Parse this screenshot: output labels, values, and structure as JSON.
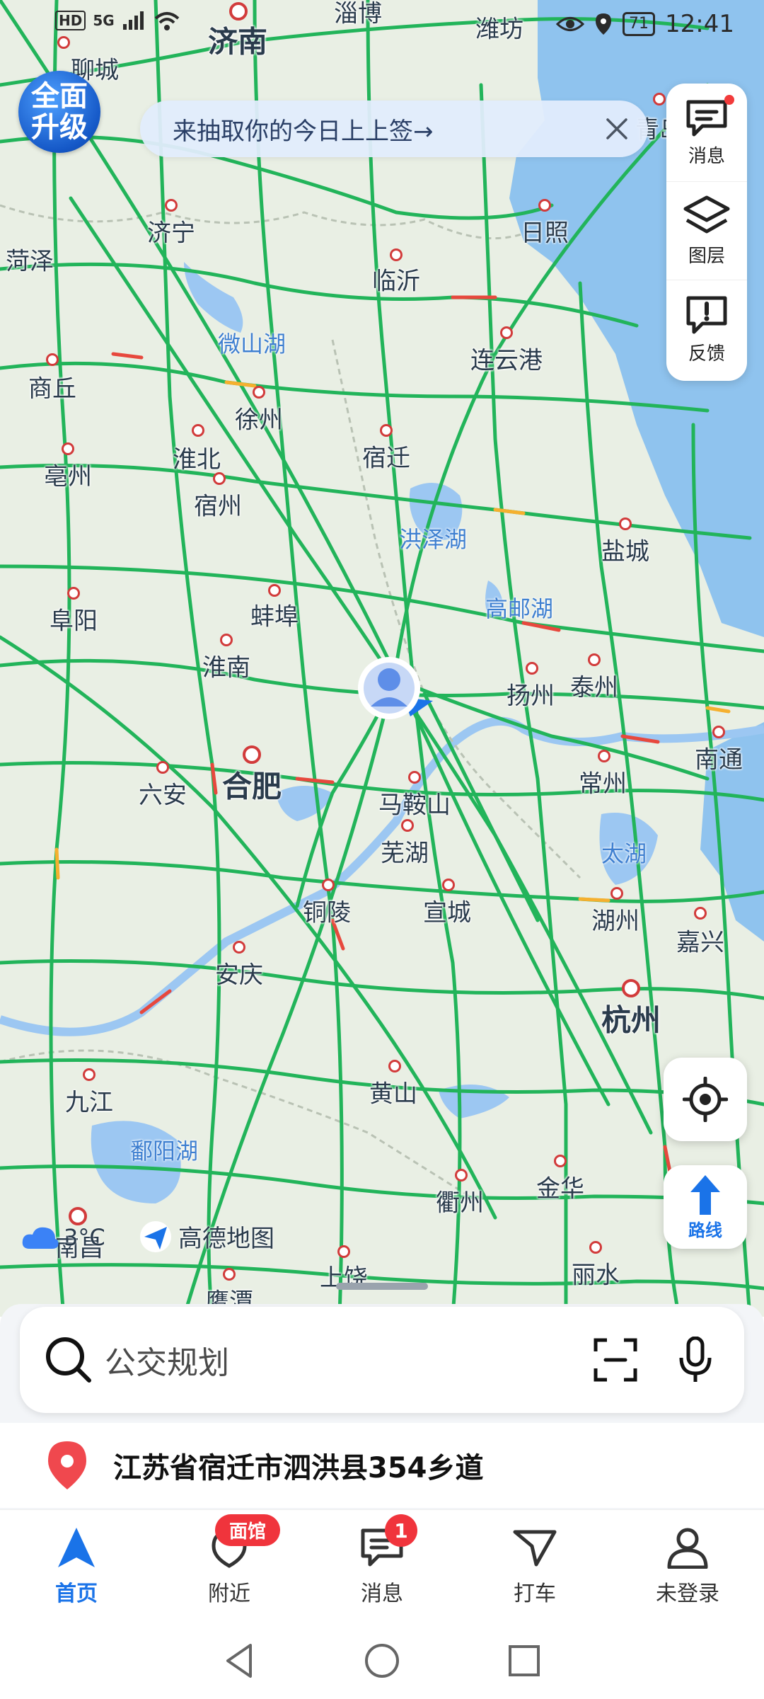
{
  "status_bar": {
    "hd": "HD",
    "signal": "5G",
    "battery": "71",
    "time": "12:41"
  },
  "upgrade_badge": {
    "line1": "全面",
    "line2": "升级"
  },
  "banner": {
    "text": "来抽取你的今日上上签→"
  },
  "map_tools": {
    "messages": "消息",
    "layers": "图层",
    "feedback": "反馈"
  },
  "route_button": {
    "label": "路线"
  },
  "map": {
    "cities": [
      "济南",
      "淄博",
      "潍坊",
      "青岛",
      "聊城",
      "济宁",
      "日照",
      "菏泽",
      "临沂",
      "连云港",
      "商丘",
      "徐州",
      "淮北",
      "宿迁",
      "亳州",
      "宿州",
      "盐城",
      "阜阳",
      "蚌埠",
      "淮南",
      "扬州",
      "泰州",
      "南通",
      "合肥",
      "六安",
      "马鞍山",
      "常州",
      "芜湖",
      "铜陵",
      "宣城",
      "湖州",
      "嘉兴",
      "安庆",
      "杭州",
      "九江",
      "黄山",
      "金华",
      "衢州",
      "南昌",
      "上饶",
      "丽水",
      "鹰潭"
    ],
    "lakes": [
      "微山湖",
      "洪泽湖",
      "高邮湖",
      "太湖",
      "鄱阳湖"
    ]
  },
  "weather": {
    "temp": "3°C"
  },
  "brand": {
    "name": "高德地图"
  },
  "search": {
    "placeholder": "公交规划"
  },
  "location": {
    "text": "江苏省宿迁市泗洪县354乡道"
  },
  "tabs": [
    {
      "label": "首页"
    },
    {
      "label": "附近",
      "tag": "面馆"
    },
    {
      "label": "消息",
      "badge": "1"
    },
    {
      "label": "打车"
    },
    {
      "label": "未登录"
    }
  ],
  "colors": {
    "accent": "#1a73e8",
    "road": "#22b45a",
    "sea": "#8fc3ee",
    "alert": "#f0343c"
  }
}
